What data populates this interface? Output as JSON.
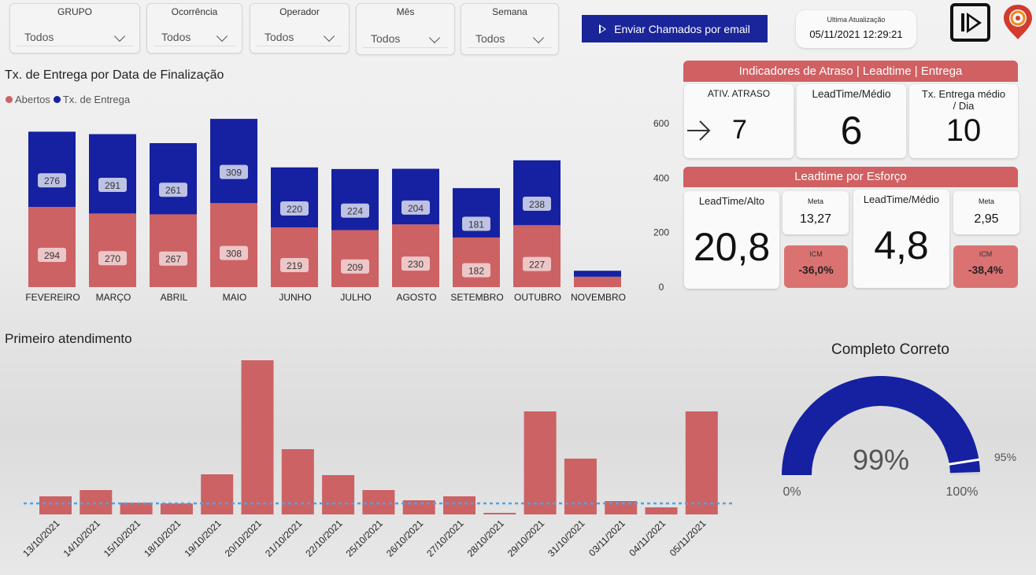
{
  "slicers": [
    {
      "title": "GRUPO",
      "value": "Todos"
    },
    {
      "title": "Ocorrência",
      "value": "Todos"
    },
    {
      "title": "Operador",
      "value": "Todos"
    },
    {
      "title": "Mês",
      "value": "Todos"
    },
    {
      "title": "Semana",
      "value": "Todos"
    }
  ],
  "send_button": {
    "label": "Enviar Chamados por email"
  },
  "last_update": {
    "label": "Ultima Atualização",
    "value": "05/11/2021 12:29:21"
  },
  "colors": {
    "red": "#cc6264",
    "blue": "#1521a0",
    "header_red": "#d06062",
    "icm_red": "#db7272",
    "dotted_line": "#4da3e8"
  },
  "entrega_chart": {
    "title": "Tx. de Entrega por Data de Finalização",
    "legend": [
      {
        "name": "Abertos",
        "color": "#cc6264"
      },
      {
        "name": "Tx. de Entrega",
        "color": "#1521a0"
      }
    ]
  },
  "indicators": {
    "header": "Indicadores de Atraso | Leadtime | Entrega",
    "ativ_atraso": {
      "label": "ATIV. ATRASO",
      "value": "7",
      "icon": "arrow-right-icon"
    },
    "leadtime_medio": {
      "label": "LeadTime/Médio",
      "value": "6"
    },
    "tx_entrega": {
      "label": "Tx. Entrega médio / Dia",
      "value": "10"
    }
  },
  "esforco": {
    "header": "Leadtime por Esforço",
    "alto": {
      "label": "LeadTime/Alto",
      "value": "20,8",
      "meta_label": "Meta",
      "meta_value": "13,27",
      "icm_label": "ICM",
      "icm_value": "-36,0%"
    },
    "medio": {
      "label": "LeadTime/Médio",
      "value": "4,8",
      "meta_label": "Meta",
      "meta_value": "2,95",
      "icm_label": "ICM",
      "icm_value": "-38,4%"
    }
  },
  "primeiro_chart": {
    "title": "Primeiro atendimento"
  },
  "gauge": {
    "title": "Completo Correto",
    "value_label": "99%",
    "value": 0.99,
    "min_label": "0%",
    "max_label": "100%",
    "target_label": "95%",
    "target": 0.95
  },
  "chart_data": [
    {
      "type": "bar",
      "stacked": true,
      "title": "Tx. de Entrega por Data de Finalização",
      "categories": [
        "FEVEREIRO",
        "MARÇO",
        "ABRIL",
        "MAIO",
        "JUNHO",
        "JULHO",
        "AGOSTO",
        "SETEMBRO",
        "OUTUBRO",
        "NOVEMBRO"
      ],
      "series": [
        {
          "name": "Abertos",
          "values": [
            294,
            270,
            267,
            308,
            219,
            209,
            230,
            182,
            227,
            38
          ],
          "labels": [
            "294",
            "270",
            "267",
            "308",
            "219",
            "209",
            "230",
            "182",
            "227",
            ""
          ]
        },
        {
          "name": "Tx. de Entrega",
          "values": [
            276,
            291,
            261,
            309,
            220,
            224,
            204,
            181,
            238,
            22
          ],
          "labels": [
            "276",
            "291",
            "261",
            "309",
            "220",
            "224",
            "204",
            "181",
            "238",
            ""
          ]
        }
      ],
      "yticks": [
        "0",
        "200",
        "400",
        "600"
      ],
      "ylim": [
        0,
        620
      ],
      "grid": false,
      "legend_position": "top-left"
    },
    {
      "type": "bar",
      "title": "Primeiro atendimento",
      "categories": [
        "13/10/2021",
        "14/10/2021",
        "15/10/2021",
        "18/10/2021",
        "19/10/2021",
        "20/10/2021",
        "21/10/2021",
        "22/10/2021",
        "25/10/2021",
        "26/10/2021",
        "27/10/2021",
        "28/10/2021",
        "29/10/2021",
        "31/10/2021",
        "03/11/2021",
        "04/11/2021",
        "05/11/2021"
      ],
      "values": [
        23,
        31,
        15,
        14,
        51,
        196,
        83,
        50,
        31,
        18,
        23,
        2,
        131,
        71,
        17,
        9,
        131
      ],
      "reference_line": 14,
      "ylim": [
        0,
        200
      ],
      "grid": false
    }
  ]
}
